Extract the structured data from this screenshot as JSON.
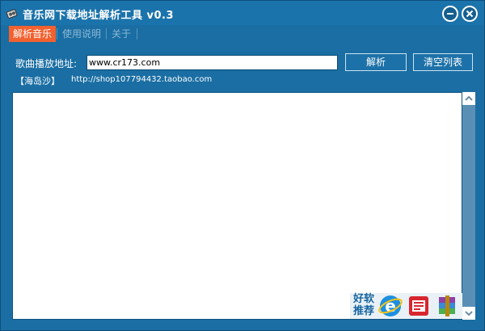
{
  "window": {
    "title": "音乐网下载地址解析工具 v0.3",
    "minimize_icon": "minimize-icon",
    "close_icon": "close-icon"
  },
  "tabs": [
    {
      "label": "解析音乐",
      "active": true
    },
    {
      "label": "使用说明",
      "active": false
    },
    {
      "label": "关于",
      "active": false
    }
  ],
  "form": {
    "url_label": "歌曲播放地址:",
    "url_value": "www.cr173.com",
    "parse_button": "解析",
    "clear_button": "清空列表"
  },
  "author": {
    "name": "【海岛沙】",
    "shop_link": "http://shop107794432.taobao.com"
  },
  "promo": {
    "line1": "好软",
    "line2": "推荐",
    "icons": [
      "ie-browser-icon",
      "news-icon",
      "winrar-icon"
    ]
  },
  "colors": {
    "window_bg": "#1a6ea3",
    "active_tab": "#f2612f",
    "list_bg": "#ffffff"
  }
}
